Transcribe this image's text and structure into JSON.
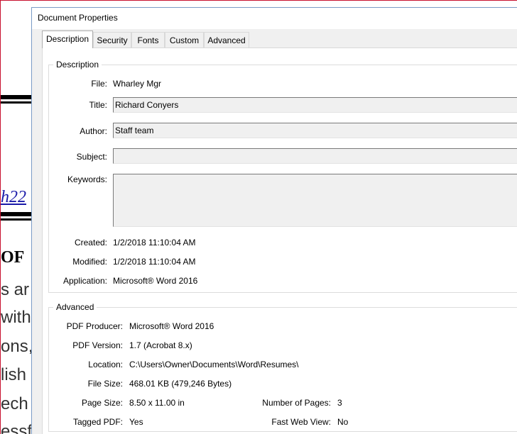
{
  "background": {
    "lines": [
      "h22",
      "OF",
      "s ar",
      "with",
      "ons,",
      "lish",
      "ech",
      "essf"
    ]
  },
  "dialog": {
    "title": "Document Properties",
    "tabs": [
      {
        "label": "Description",
        "active": true
      },
      {
        "label": "Security"
      },
      {
        "label": "Fonts"
      },
      {
        "label": "Custom"
      },
      {
        "label": "Advanced"
      }
    ],
    "description": {
      "section_title": "Description",
      "file_label": "File:",
      "file_value": "Wharley Mgr",
      "title_label": "Title:",
      "title_value": "Richard Conyers",
      "author_label": "Author:",
      "author_value": "Staff team",
      "subject_label": "Subject:",
      "subject_value": "",
      "keywords_label": "Keywords:",
      "keywords_value": "",
      "created_label": "Created:",
      "created_value": "1/2/2018 11:10:04 AM",
      "modified_label": "Modified:",
      "modified_value": "1/2/2018 11:10:04 AM",
      "application_label": "Application:",
      "application_value": "Microsoft® Word 2016"
    },
    "advanced": {
      "section_title": "Advanced",
      "pdf_producer_label": "PDF Producer:",
      "pdf_producer_value": "Microsoft® Word 2016",
      "pdf_version_label": "PDF Version:",
      "pdf_version_value": "1.7 (Acrobat 8.x)",
      "location_label": "Location:",
      "location_value": "C:\\Users\\Owner\\Documents\\Word\\Resumes\\",
      "file_size_label": "File Size:",
      "file_size_value": "468.01 KB (479,246 Bytes)",
      "page_size_label": "Page Size:",
      "page_size_value": "8.50 x 11.00 in",
      "num_pages_label": "Number of Pages:",
      "num_pages_value": "3",
      "tagged_pdf_label": "Tagged PDF:",
      "tagged_pdf_value": "Yes",
      "fast_web_label": "Fast Web View:",
      "fast_web_value": "No"
    }
  }
}
